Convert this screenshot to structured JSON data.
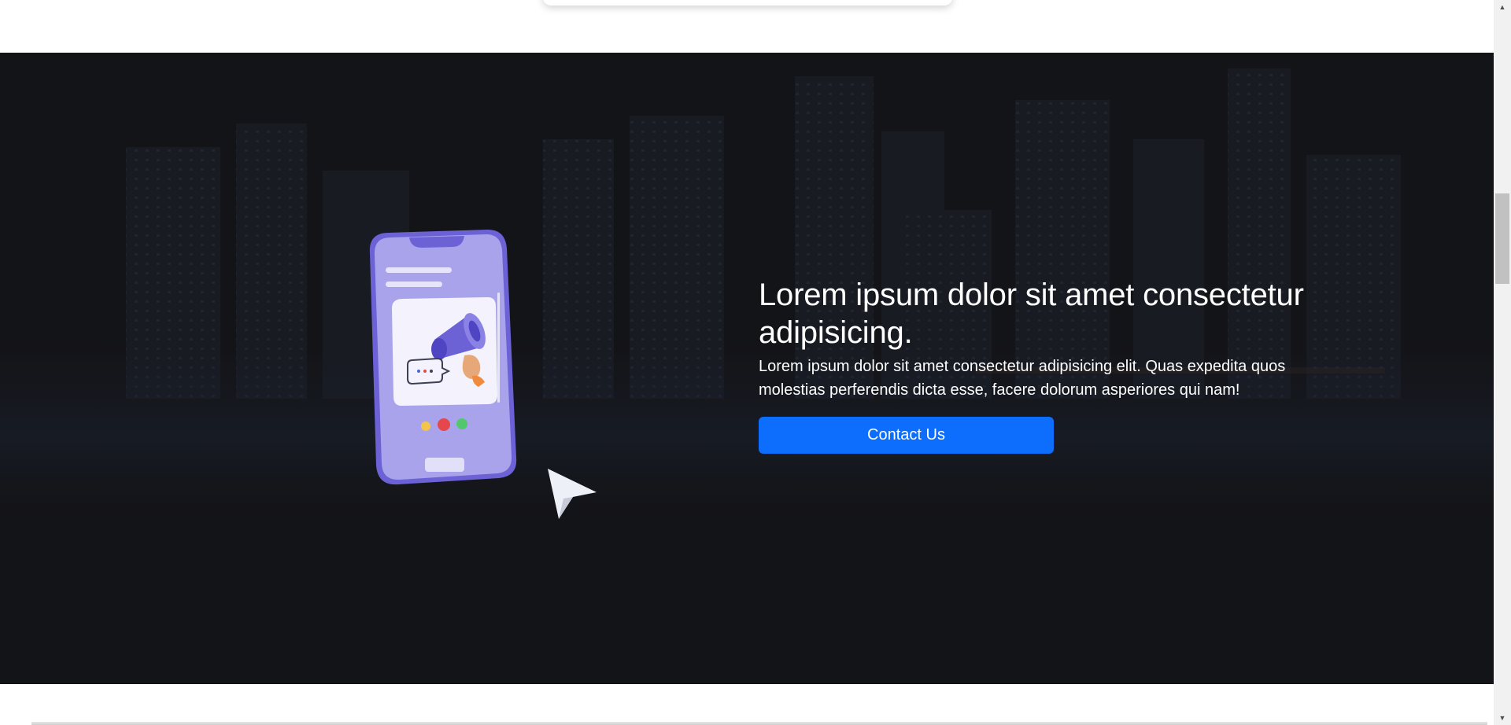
{
  "hero": {
    "heading": "Lorem ipsum dolor sit amet consectetur adipisicing.",
    "text": "Lorem ipsum dolor sit amet consectetur adipisicing elit. Quas expedita quos molestias perferendis dicta esse, facere dolorum asperiores qui nam!",
    "button_label": "Contact Us"
  },
  "colors": {
    "hero_background": "#131418",
    "accent_button": "#0d6efd",
    "phone_body": "#a49ee9",
    "phone_frame": "#6c62d6"
  },
  "illustration": {
    "icons": [
      "phone-icon",
      "megaphone-icon",
      "chat-bubble-icon",
      "cursor-arrow-icon"
    ]
  }
}
